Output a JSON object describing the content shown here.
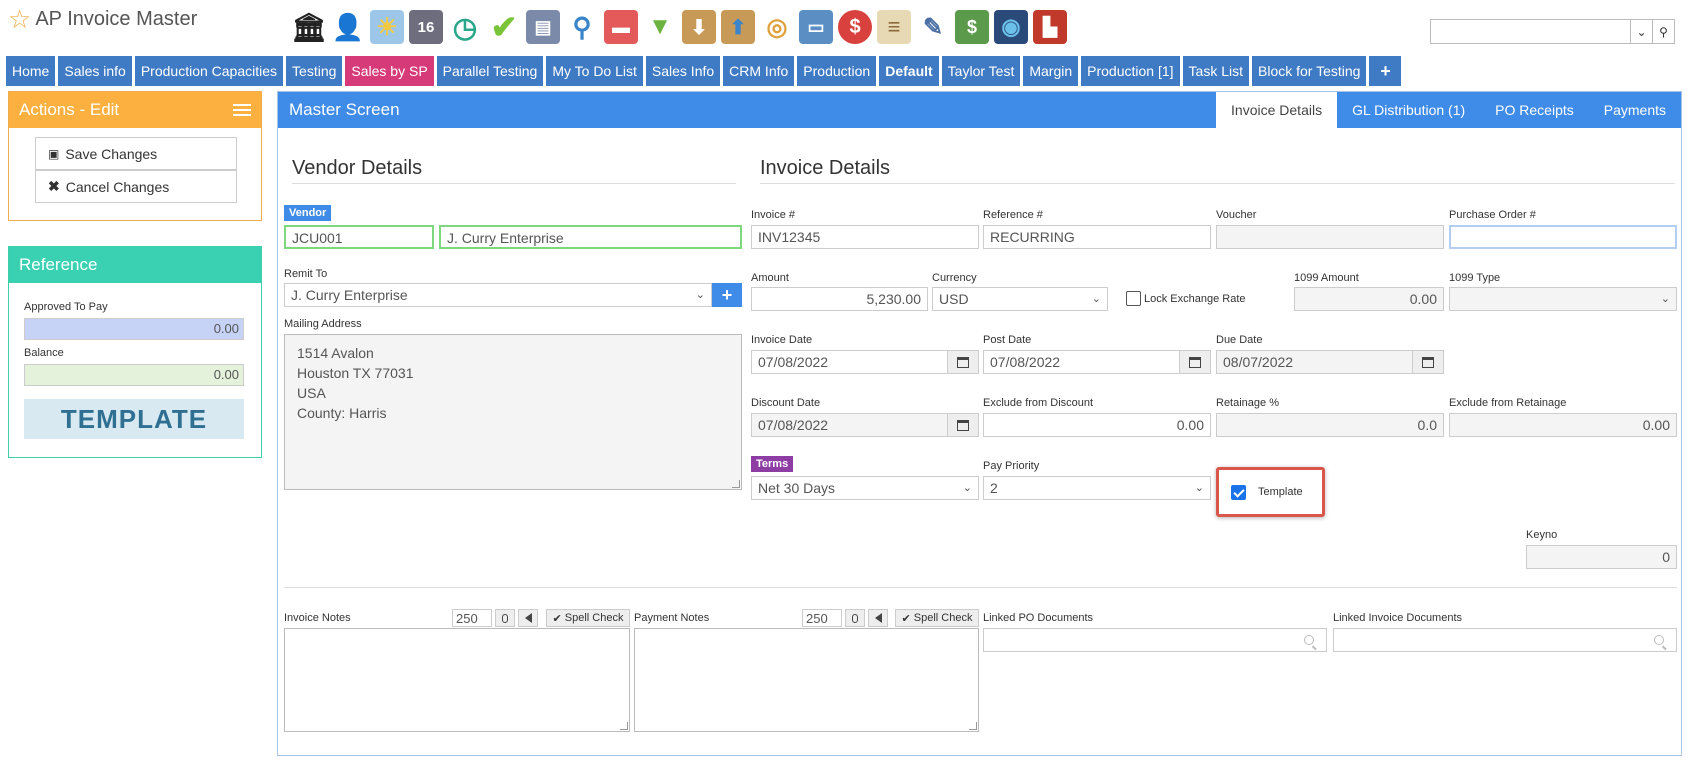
{
  "app": {
    "title": "AP Invoice Master"
  },
  "toolbar": {
    "icons": [
      "bank-icon",
      "user-icon",
      "weather-icon",
      "calendar-16-icon",
      "clock-icon",
      "checkmark-icon",
      "monitor-icon",
      "magnifier-icon",
      "truck-icon",
      "basket-icon",
      "inbox-download-icon",
      "inbox-upload-icon",
      "coins-icon",
      "presentation-icon",
      "dollar-bubble-icon",
      "clipboard-icon",
      "pencil-icon",
      "money-icon",
      "globe-device-icon",
      "factory-icon"
    ],
    "calendar_day": "16"
  },
  "search": {
    "placeholder": ""
  },
  "nav": {
    "tabs": [
      "Home",
      "Sales info",
      "Production Capacities",
      "Testing",
      "Sales by SP",
      "Parallel Testing",
      "My To Do List",
      "Sales Info",
      "CRM Info",
      "Production",
      "Default",
      "Taylor Test",
      "Margin",
      "Production [1]",
      "Task List",
      "Block for Testing"
    ],
    "add_label": "+"
  },
  "actions": {
    "title": "Actions - Edit",
    "save_label": "Save Changes",
    "cancel_label": "Cancel Changes"
  },
  "reference": {
    "title": "Reference",
    "approved_label": "Approved To Pay",
    "approved_value": "0.00",
    "balance_label": "Balance",
    "balance_value": "0.00",
    "template_banner": "TEMPLATE"
  },
  "master": {
    "title": "Master Screen",
    "tabs": [
      "Invoice Details",
      "GL Distribution (1)",
      "PO Receipts",
      "Payments"
    ]
  },
  "vendor": {
    "section_title": "Vendor Details",
    "vendor_badge": "Vendor",
    "vendor_code": "JCU001",
    "vendor_name": "J. Curry Enterprise",
    "remit_label": "Remit To",
    "remit_value": "J. Curry Enterprise",
    "mailing_label": "Mailing Address",
    "mailing_lines": [
      "1514 Avalon",
      "Houston TX  77031",
      "USA",
      "County: Harris"
    ]
  },
  "invoice": {
    "section_title": "Invoice Details",
    "invoice_no_label": "Invoice #",
    "invoice_no": "INV12345",
    "reference_label": "Reference #",
    "reference": "RECURRING",
    "voucher_label": "Voucher",
    "voucher": "",
    "po_label": "Purchase Order #",
    "po": "",
    "amount_label": "Amount",
    "amount": "5,230.00",
    "currency_label": "Currency",
    "currency": "USD",
    "lock_rate_label": "Lock Exchange Rate",
    "amt1099_label": "1099 Amount",
    "amt1099": "0.00",
    "type1099_label": "1099 Type",
    "type1099": "",
    "invoice_date_label": "Invoice Date",
    "invoice_date": "07/08/2022",
    "post_date_label": "Post Date",
    "post_date": "07/08/2022",
    "due_date_label": "Due Date",
    "due_date": "08/07/2022",
    "discount_date_label": "Discount Date",
    "discount_date": "07/08/2022",
    "excl_discount_label": "Exclude from Discount",
    "excl_discount": "0.00",
    "retainage_label": "Retainage %",
    "retainage": "0.0",
    "excl_retainage_label": "Exclude from Retainage",
    "excl_retainage": "0.00",
    "terms_badge": "Terms",
    "terms": "Net 30 Days",
    "pay_priority_label": "Pay Priority",
    "pay_priority": "2",
    "template_label": "Template",
    "keyno_label": "Keyno",
    "keyno": "0"
  },
  "notes": {
    "invoice_notes_label": "Invoice Notes",
    "payment_notes_label": "Payment Notes",
    "char_limit": "250",
    "spell_check_label": "Spell Check",
    "linked_po_label": "Linked PO Documents",
    "linked_invoice_label": "Linked Invoice Documents"
  },
  "colors": {
    "nav_blue": "#3f7ac4",
    "nav_pink": "#d63a78",
    "actions_orange": "#fbb040",
    "reference_teal": "#3ad1b3",
    "master_blue": "#3f8be8",
    "highlight_red": "#d8564a"
  }
}
